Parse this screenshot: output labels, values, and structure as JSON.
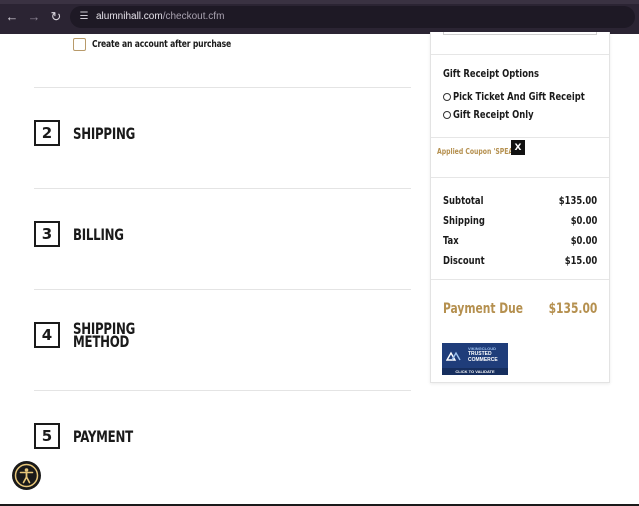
{
  "browser": {
    "url_host": "alumnihall.com",
    "url_path": "/checkout.cfm"
  },
  "account": {
    "create_label": "Create an account after purchase",
    "checked": false
  },
  "steps": [
    {
      "number": "2",
      "title": "SHIPPING"
    },
    {
      "number": "3",
      "title": "BILLING"
    },
    {
      "number": "4",
      "title_line1": "SHIPPING",
      "title_line2": "METHOD"
    },
    {
      "number": "5",
      "title": "PAYMENT"
    }
  ],
  "gift_receipt": {
    "title": "Gift Receipt Options",
    "options": [
      "Pick Ticket And Gift Receipt",
      "Gift Receipt Only"
    ]
  },
  "coupon": {
    "text": "Applied Coupon 'SPEAR'",
    "remove_label": "X"
  },
  "totals": {
    "subtotal_label": "Subtotal",
    "subtotal_value": "$135.00",
    "shipping_label": "Shipping",
    "shipping_value": "$0.00",
    "tax_label": "Tax",
    "tax_value": "$0.00",
    "discount_label": "Discount",
    "discount_value": "$15.00"
  },
  "payment_due": {
    "label": "Payment Due",
    "value": "$135.00"
  },
  "trust_badge": {
    "line1": "VIKINGCLOUD",
    "line2": "TRUSTED",
    "line3": "COMMERCE",
    "footer": "CLICK TO VALIDATE"
  },
  "colors": {
    "accent_gold": "#b5904f",
    "browser_bg": "#2b2433",
    "badge_blue": "#1f3d7a"
  },
  "icons": [
    "back-arrow-icon",
    "forward-arrow-icon",
    "reload-icon",
    "site-settings-icon",
    "accessibility-icon",
    "viking-logo-icon"
  ]
}
